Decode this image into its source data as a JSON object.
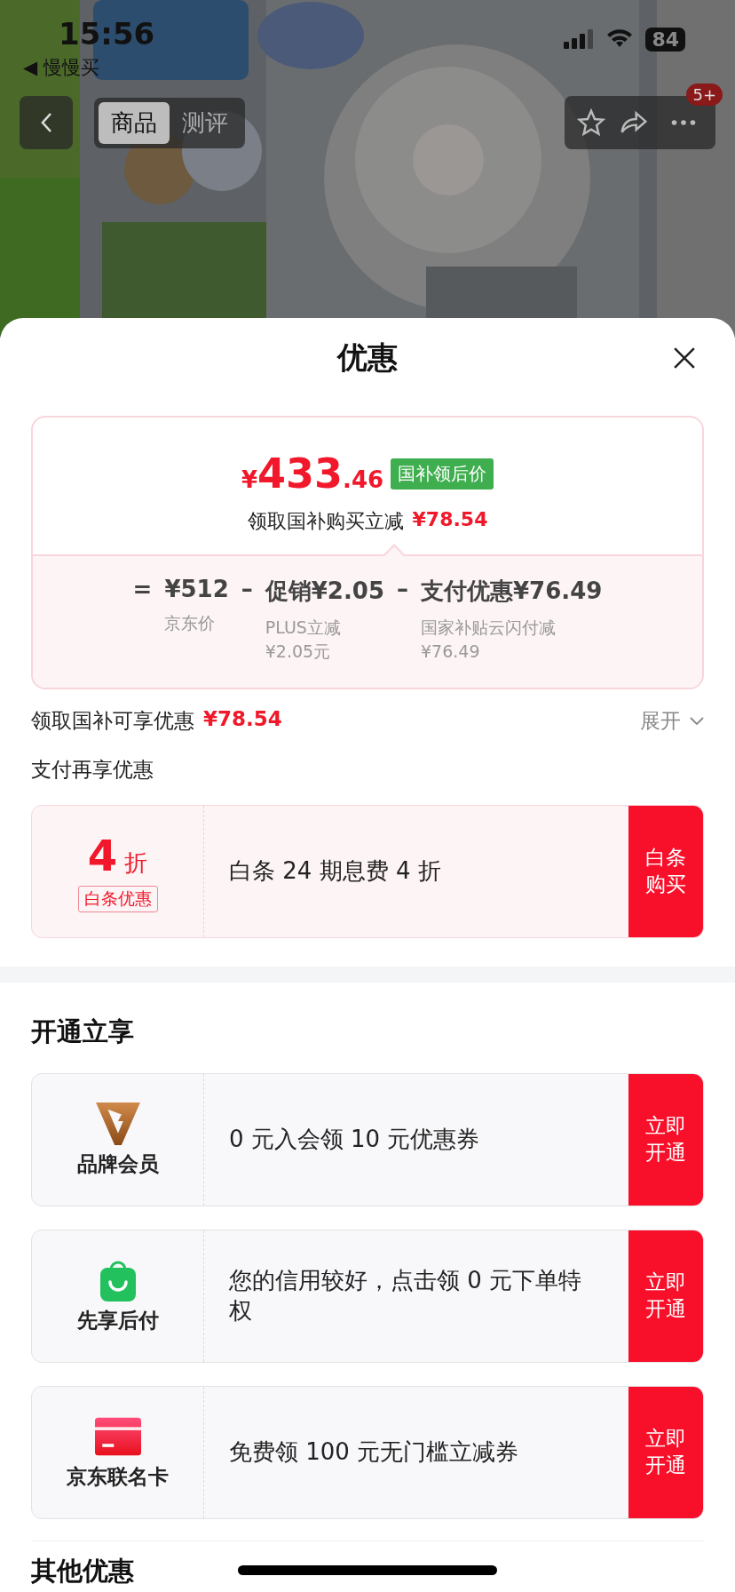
{
  "status_bar": {
    "time": "15:56",
    "back_app": "◀ 慢慢买",
    "battery": "84"
  },
  "nav": {
    "tabs": [
      {
        "label": "商品",
        "selected": true
      },
      {
        "label": "测评",
        "selected": false
      }
    ],
    "badge": "5+"
  },
  "sheet": {
    "title": "优惠",
    "price_card": {
      "currency": "¥",
      "price_int": "433",
      "price_dec": ".46",
      "tag": "国补领后价",
      "saving_label": "领取国补购买立减",
      "saving_amount": "¥78.54",
      "breakdown": [
        {
          "operator": "=",
          "value": "¥512",
          "notes": [
            "京东价"
          ]
        },
        {
          "operator": "–",
          "value": "促销¥2.05",
          "notes": [
            "PLUS立减",
            "¥2.05元"
          ]
        },
        {
          "operator": "–",
          "value": "支付优惠¥76.49",
          "notes": [
            "国家补贴云闪付减",
            "¥76.49"
          ]
        }
      ]
    },
    "summary": {
      "label": "领取国补可享优惠",
      "amount": "¥78.54",
      "toggle": "展开",
      "expanded": false
    },
    "pay_title": "支付再享优惠",
    "pay_offers": [
      {
        "kind": "discount",
        "big": "4",
        "unit": "折",
        "tag": "白条优惠",
        "text": "白条 24 期息费 4 折",
        "action": "白条购买"
      }
    ],
    "open_title": "开通立享",
    "open_offers": [
      {
        "kind": "brand_member",
        "name": "品牌会员",
        "text": "0 元入会领 10 元优惠券",
        "action": "立即开通"
      },
      {
        "kind": "pay_later",
        "name": "先享后付",
        "text": "您的信用较好，点击领 0 元下单特权",
        "action": "立即开通"
      },
      {
        "kind": "card",
        "name": "京东联名卡",
        "text": "免费领 100 元无门槛立减券",
        "action": "立即开通"
      }
    ],
    "other_title": "其他优惠"
  }
}
